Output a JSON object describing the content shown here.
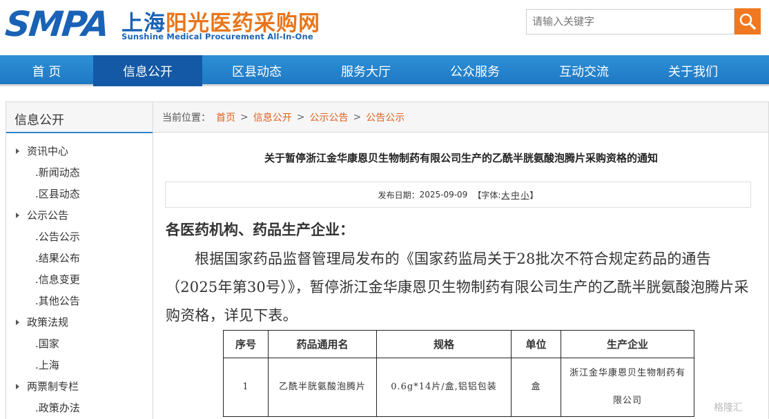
{
  "header": {
    "logo_smpa": "SMPA",
    "logo_cn_part1": "上海",
    "logo_cn_part2": "阳光医药采购网",
    "logo_en": "Sunshine Medical Procurement All-In-One",
    "search_placeholder": "请输入关键字",
    "accent": "#f07820",
    "brand": "#1a62b6"
  },
  "nav": {
    "items": [
      "首 页",
      "信息公开",
      "区县动态",
      "服务大厅",
      "公众服务",
      "互动交流",
      "关于我们"
    ],
    "active": "信息公开"
  },
  "sidebar": {
    "title": "信息公开",
    "groups": [
      {
        "label": "资讯中心",
        "items": [
          ".新闻动态",
          ".区县动态"
        ]
      },
      {
        "label": "公示公告",
        "items": [
          ".公告公示",
          ".结果公布",
          ".信息变更",
          ".其他公告"
        ]
      },
      {
        "label": "政策法规",
        "items": [
          ".国家",
          ".上海"
        ]
      },
      {
        "label": "两票制专栏",
        "items": [
          ".政策办法"
        ]
      }
    ]
  },
  "breadcrumb": {
    "prefix": "当前位置：",
    "items": [
      "首页",
      "信息公开",
      "公示公告",
      "公告公示"
    ],
    "sep": ">"
  },
  "article": {
    "title": "关于暂停浙江金华康恩贝生物制药有限公司生产的乙酰半胱氨酸泡腾片采购资格的通知",
    "date_label": "发布日期：",
    "date": "2025-09-09",
    "font_prefix": "【字体:",
    "font_sizes": [
      "大",
      "中",
      "小"
    ],
    "font_suffix": "】",
    "salutation": "各医药机构、药品生产企业：",
    "paragraph": "根据国家药品监督管理局发布的《国家药监局关于28批次不符合规定药品的通告（2025年第30号）》，暂停浙江金华康恩贝生物制药有限公司生产的乙酰半胱氨酸泡腾片采购资格，详见下表。"
  },
  "table": {
    "headers": [
      "序号",
      "药品通用名",
      "规格",
      "单位",
      "生产企业"
    ],
    "rows": [
      [
        "1",
        "乙酰半胱氨酸泡腾片",
        "0.6g*14片/盒,铝铝包装",
        "盒",
        "浙江金华康恩贝生物制药有限公司"
      ]
    ]
  },
  "watermark": "格隆汇"
}
